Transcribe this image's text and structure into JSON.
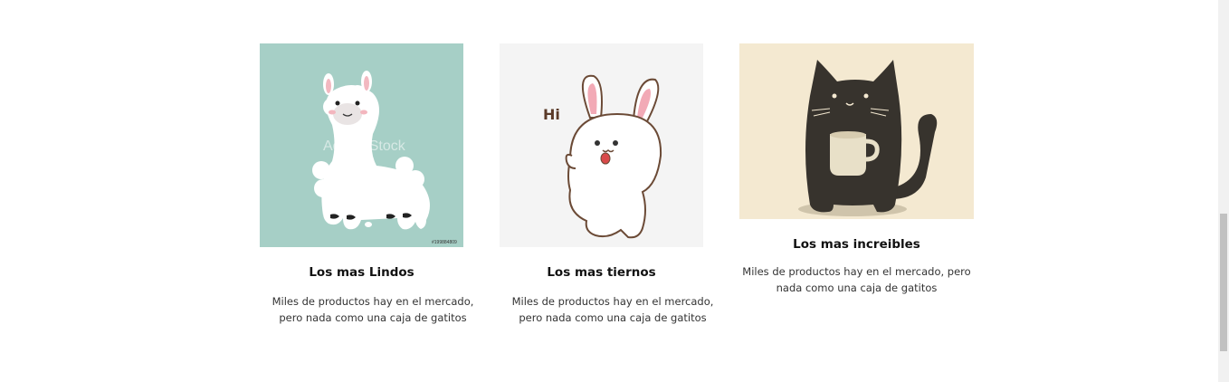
{
  "cards": [
    {
      "title": "Los mas Lindos",
      "description": "Miles de productos hay en el mercado, pero nada como una caja de gatitos",
      "image": {
        "subject": "alpaca",
        "background": "#a6cfc6",
        "watermark": "Adobe Stock",
        "stock_id": "#199884809"
      }
    },
    {
      "title": "Los mas tiernos",
      "description": "Miles de productos hay en el mercado, pero nada como una caja de gatitos",
      "image": {
        "subject": "bunny",
        "background": "#f4f4f4",
        "greeting": "Hi"
      }
    },
    {
      "title": "Los mas increibles",
      "description": "Miles de productos hay en el mercado, pero nada como una caja de gatitos",
      "image": {
        "subject": "cat-with-mug",
        "background": "#f4e9d1"
      }
    }
  ],
  "colors": {
    "accent_dark": "#37332d",
    "scrollbar_track": "#f1f1f1",
    "scrollbar_thumb": "#c1c1c1"
  }
}
